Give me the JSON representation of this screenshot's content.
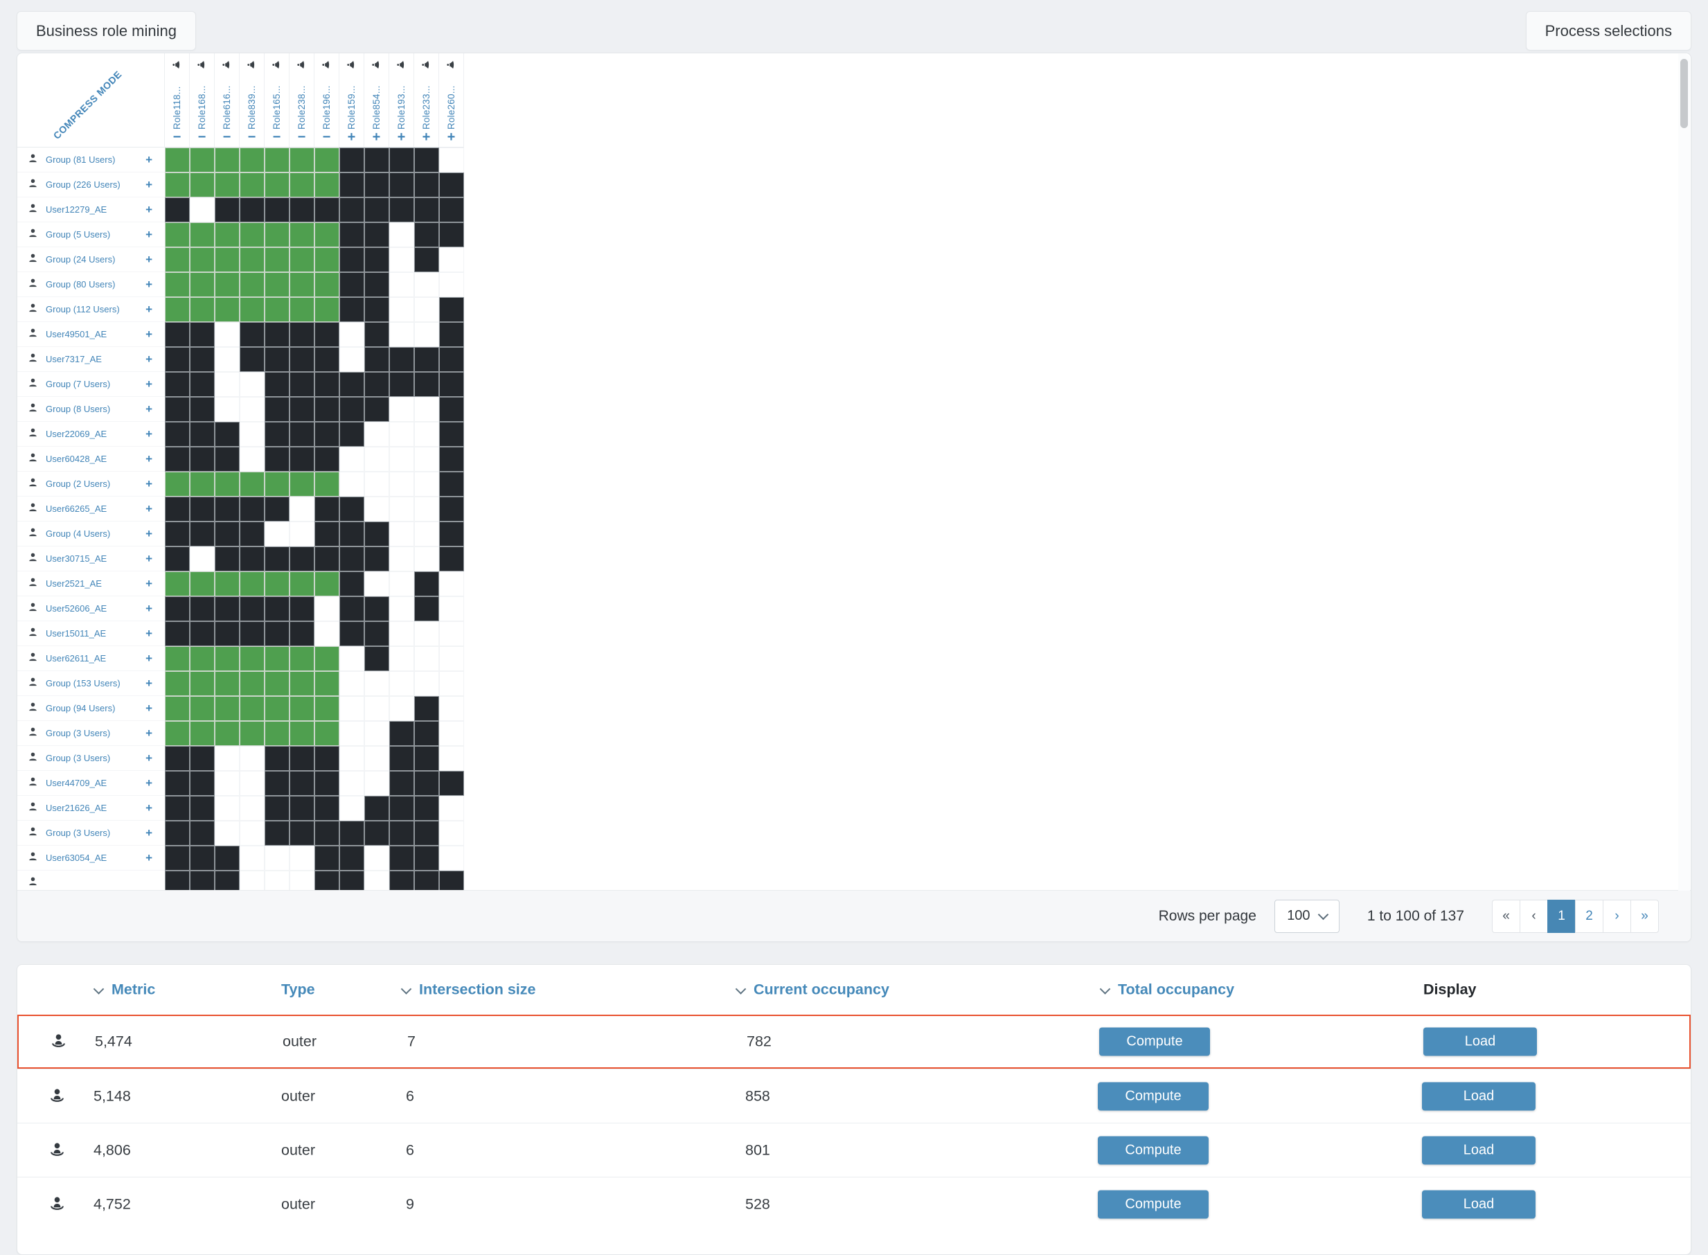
{
  "header": {
    "title": "Business role mining",
    "process_button_label": "Process selections"
  },
  "colors": {
    "accent_blue": "#4285b8",
    "button_blue": "#4b8dbb",
    "active_page_blue": "#4787b4",
    "cell_green": "#4f9f4f",
    "cell_dark": "#23272c",
    "highlight_red": "#e8502d",
    "page_background": "#eef0f3"
  },
  "matrix": {
    "compress_mode_label": "COMPRESS MODE",
    "plus_glyph": "+",
    "cell_legend": {
      "g": "green-selected",
      "d": "dark-assigned",
      "w": "empty"
    },
    "columns": [
      {
        "label": "Role118...",
        "icon": "speaker-icon",
        "toggle": "−"
      },
      {
        "label": "Role168...",
        "icon": "speaker-icon",
        "toggle": "−"
      },
      {
        "label": "Role616...",
        "icon": "speaker-icon",
        "toggle": "−"
      },
      {
        "label": "Role839...",
        "icon": "speaker-icon",
        "toggle": "−"
      },
      {
        "label": "Role165...",
        "icon": "speaker-icon",
        "toggle": "−"
      },
      {
        "label": "Role238...",
        "icon": "speaker-icon",
        "toggle": "−"
      },
      {
        "label": "Role196...",
        "icon": "speaker-icon",
        "toggle": "−"
      },
      {
        "label": "Role159...",
        "icon": "speaker-icon",
        "toggle": "+"
      },
      {
        "label": "Role854...",
        "icon": "speaker-icon",
        "toggle": "+"
      },
      {
        "label": "Role193...",
        "icon": "speaker-icon",
        "toggle": "+"
      },
      {
        "label": "Role233...",
        "icon": "speaker-icon",
        "toggle": "+"
      },
      {
        "label": "Role260...",
        "icon": "speaker-icon",
        "toggle": "+"
      }
    ],
    "rows": [
      {
        "label": "Group (81 Users)",
        "icon": "user-icon",
        "cells": "gggggggddddw"
      },
      {
        "label": "Group (226 Users)",
        "icon": "user-icon",
        "cells": "gggggggddddd"
      },
      {
        "label": "User12279_AE",
        "icon": "user-icon",
        "cells": "dwdddddddddd"
      },
      {
        "label": "Group (5 Users)",
        "icon": "user-icon",
        "cells": "gggggggddwdd"
      },
      {
        "label": "Group (24 Users)",
        "icon": "user-icon",
        "cells": "gggggggddwdw"
      },
      {
        "label": "Group (80 Users)",
        "icon": "user-icon",
        "cells": "gggggggddwww"
      },
      {
        "label": "Group (112 Users)",
        "icon": "user-icon",
        "cells": "gggggggddwwd"
      },
      {
        "label": "User49501_AE",
        "icon": "user-icon",
        "cells": "ddwddddwdwwd"
      },
      {
        "label": "User7317_AE",
        "icon": "user-icon",
        "cells": "ddwddddwdddd"
      },
      {
        "label": "Group (7 Users)",
        "icon": "user-icon",
        "cells": "ddwwdddddddd"
      },
      {
        "label": "Group (8 Users)",
        "icon": "user-icon",
        "cells": "ddwwdddddwwd"
      },
      {
        "label": "User22069_AE",
        "icon": "user-icon",
        "cells": "dddwddddwwwd"
      },
      {
        "label": "User60428_AE",
        "icon": "user-icon",
        "cells": "dddwdddwwwwd"
      },
      {
        "label": "Group (2 Users)",
        "icon": "user-icon",
        "cells": "gggggggwwwwd"
      },
      {
        "label": "User66265_AE",
        "icon": "user-icon",
        "cells": "dddddwddwwwd"
      },
      {
        "label": "Group (4 Users)",
        "icon": "user-icon",
        "cells": "ddddwwdddwwd"
      },
      {
        "label": "User30715_AE",
        "icon": "user-icon",
        "cells": "dwdddddddwwd"
      },
      {
        "label": "User2521_AE",
        "icon": "user-icon",
        "cells": "gggggggdwwdw"
      },
      {
        "label": "User52606_AE",
        "icon": "user-icon",
        "cells": "ddddddwddwdw"
      },
      {
        "label": "User15011_AE",
        "icon": "user-icon",
        "cells": "ddddddwddwww"
      },
      {
        "label": "User62611_AE",
        "icon": "user-icon",
        "cells": "gggggggwdwww"
      },
      {
        "label": "Group (153 Users)",
        "icon": "user-icon",
        "cells": "gggggggwwwww"
      },
      {
        "label": "Group (94 Users)",
        "icon": "user-icon",
        "cells": "gggggggwwwdw"
      },
      {
        "label": "Group (3 Users)",
        "icon": "user-icon",
        "cells": "gggggggwwddw"
      },
      {
        "label": "Group (3 Users)",
        "icon": "user-icon",
        "cells": "ddwwdddwwddw"
      },
      {
        "label": "User44709_AE",
        "icon": "user-icon",
        "cells": "ddwwdddwwddd"
      },
      {
        "label": "User21626_AE",
        "icon": "user-icon",
        "cells": "ddwwdddwdddw"
      },
      {
        "label": "Group (3 Users)",
        "icon": "user-icon",
        "cells": "ddwwdddddddw"
      },
      {
        "label": "User63054_AE",
        "icon": "user-icon",
        "cells": "dddwwwddwddw"
      },
      {
        "label": "",
        "icon": "user-icon",
        "cells": "dddwwwddwddd"
      }
    ]
  },
  "pagination": {
    "rows_per_page_label": "Rows per page",
    "rows_per_page_value": "100",
    "range_text": "1 to 100 of 137",
    "buttons": [
      {
        "label": "«",
        "state": "nav-disabled",
        "name": "first-page-button"
      },
      {
        "label": "‹",
        "state": "nav-disabled",
        "name": "prev-page-button"
      },
      {
        "label": "1",
        "state": "active",
        "name": "page-1-button"
      },
      {
        "label": "2",
        "state": "page",
        "name": "page-2-button"
      },
      {
        "label": "›",
        "state": "page",
        "name": "next-page-button"
      },
      {
        "label": "»",
        "state": "page",
        "name": "last-page-button"
      }
    ]
  },
  "table": {
    "headers": [
      {
        "label": "Metric",
        "sortable": true
      },
      {
        "label": "Type",
        "sortable": false
      },
      {
        "label": "Intersection size",
        "sortable": true
      },
      {
        "label": "Current occupancy",
        "sortable": true
      },
      {
        "label": "Total occupancy",
        "sortable": true
      },
      {
        "label": "Display",
        "sortable": false
      }
    ],
    "compute_label": "Compute",
    "load_label": "Load",
    "rows": [
      {
        "icon": "user-icon",
        "metric": "5,474",
        "type": "outer",
        "intersection_size": "7",
        "current_occupancy": "782",
        "highlighted": true
      },
      {
        "icon": "user-icon",
        "metric": "5,148",
        "type": "outer",
        "intersection_size": "6",
        "current_occupancy": "858",
        "highlighted": false
      },
      {
        "icon": "user-icon",
        "metric": "4,806",
        "type": "outer",
        "intersection_size": "6",
        "current_occupancy": "801",
        "highlighted": false
      },
      {
        "icon": "user-icon",
        "metric": "4,752",
        "type": "outer",
        "intersection_size": "9",
        "current_occupancy": "528",
        "highlighted": false
      }
    ]
  }
}
